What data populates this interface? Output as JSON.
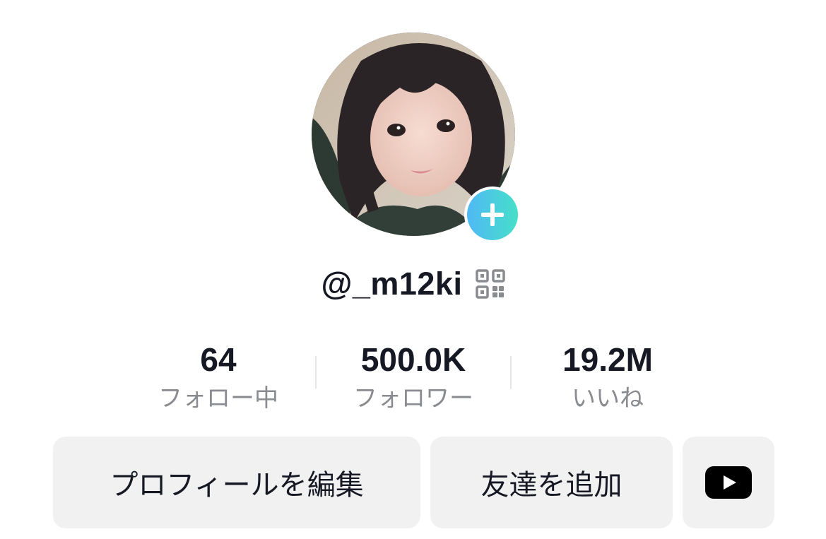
{
  "profile": {
    "username": "@_m12ki",
    "avatar_alt": "profile photo"
  },
  "stats": [
    {
      "value": "64",
      "label": "フォロー中"
    },
    {
      "value": "500.0K",
      "label": "フォロワー"
    },
    {
      "value": "19.2M",
      "label": "いいね"
    }
  ],
  "actions": {
    "edit_profile": "プロフィールを編集",
    "add_friends": "友達を追加"
  },
  "colors": {
    "accent_gradient_start": "#4fb9f5",
    "accent_gradient_end": "#46dfc9",
    "button_bg": "#f1f1f2",
    "text_primary": "#161823",
    "text_secondary": "#8a8b91"
  },
  "icons": {
    "add": "plus-icon",
    "qr": "qr-code-icon",
    "youtube": "youtube-icon"
  }
}
